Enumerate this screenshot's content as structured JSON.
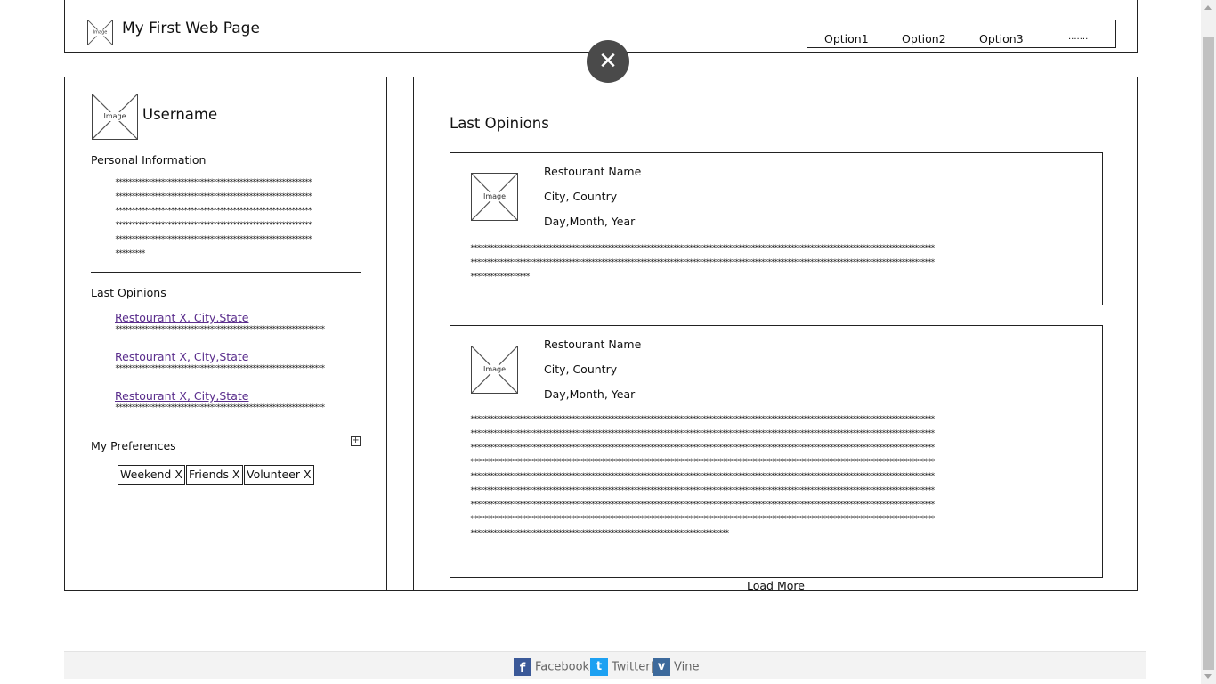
{
  "header": {
    "logo_label": "Image",
    "title": "My First Web Page",
    "nav": [
      "Option1",
      "Option2",
      "Option3",
      "......."
    ]
  },
  "close_button": {
    "icon": "close-icon",
    "glyph": "✕"
  },
  "profile": {
    "avatar_label": "Image",
    "username": "Username",
    "personal_info": {
      "title": "Personal Information",
      "lines": [
        "************************************************************",
        "************************************************************",
        "************************************************************",
        "************************************************************",
        "************************************************************",
        "*********"
      ]
    },
    "last_opinions": {
      "title": "Last Opinions",
      "items": [
        {
          "link": "Restourant X, City,State",
          "stars": "****************************************************************"
        },
        {
          "link": "Restourant X, City,State",
          "stars": "****************************************************************"
        },
        {
          "link": "Restourant X, City,State",
          "stars": "****************************************************************"
        }
      ]
    },
    "preferences": {
      "title": "My Preferences",
      "expand_glyph": "+",
      "tags": [
        "Weekend X",
        "Friends X",
        "Volunteer X"
      ]
    }
  },
  "main": {
    "title": "Last Opinions",
    "cards": [
      {
        "image_label": "Image",
        "restaurant": "Restourant Name",
        "location": "City, Country",
        "date": "Day,Month, Year",
        "lines": [
          "**********************************************************************************************************************************************",
          "**********************************************************************************************************************************************",
          "******************"
        ]
      },
      {
        "image_label": "Image",
        "restaurant": "Restourant Name",
        "location": "City, Country",
        "date": "Day,Month, Year",
        "lines": [
          "**********************************************************************************************************************************************",
          "**********************************************************************************************************************************************",
          "**********************************************************************************************************************************************",
          "**********************************************************************************************************************************************",
          "**********************************************************************************************************************************************",
          "**********************************************************************************************************************************************",
          "**********************************************************************************************************************************************",
          "**********************************************************************************************************************************************",
          "*******************************************************************************"
        ]
      }
    ],
    "load_more": "Load More"
  },
  "footer": {
    "links": [
      {
        "label": "Facebook|",
        "icon": "facebook-icon",
        "glyph": "f"
      },
      {
        "label": "Twitter|",
        "icon": "twitter-icon",
        "glyph": "t"
      },
      {
        "label": "Vine",
        "icon": "vine-icon",
        "glyph": "v"
      }
    ]
  },
  "colors": {
    "link": "#5a2d8c",
    "close_bg": "#4a4a4a",
    "facebook": "#3b5998",
    "twitter": "#1da1f2",
    "vine": "#3d6a9c",
    "footer_bg": "#f3f3f3"
  }
}
